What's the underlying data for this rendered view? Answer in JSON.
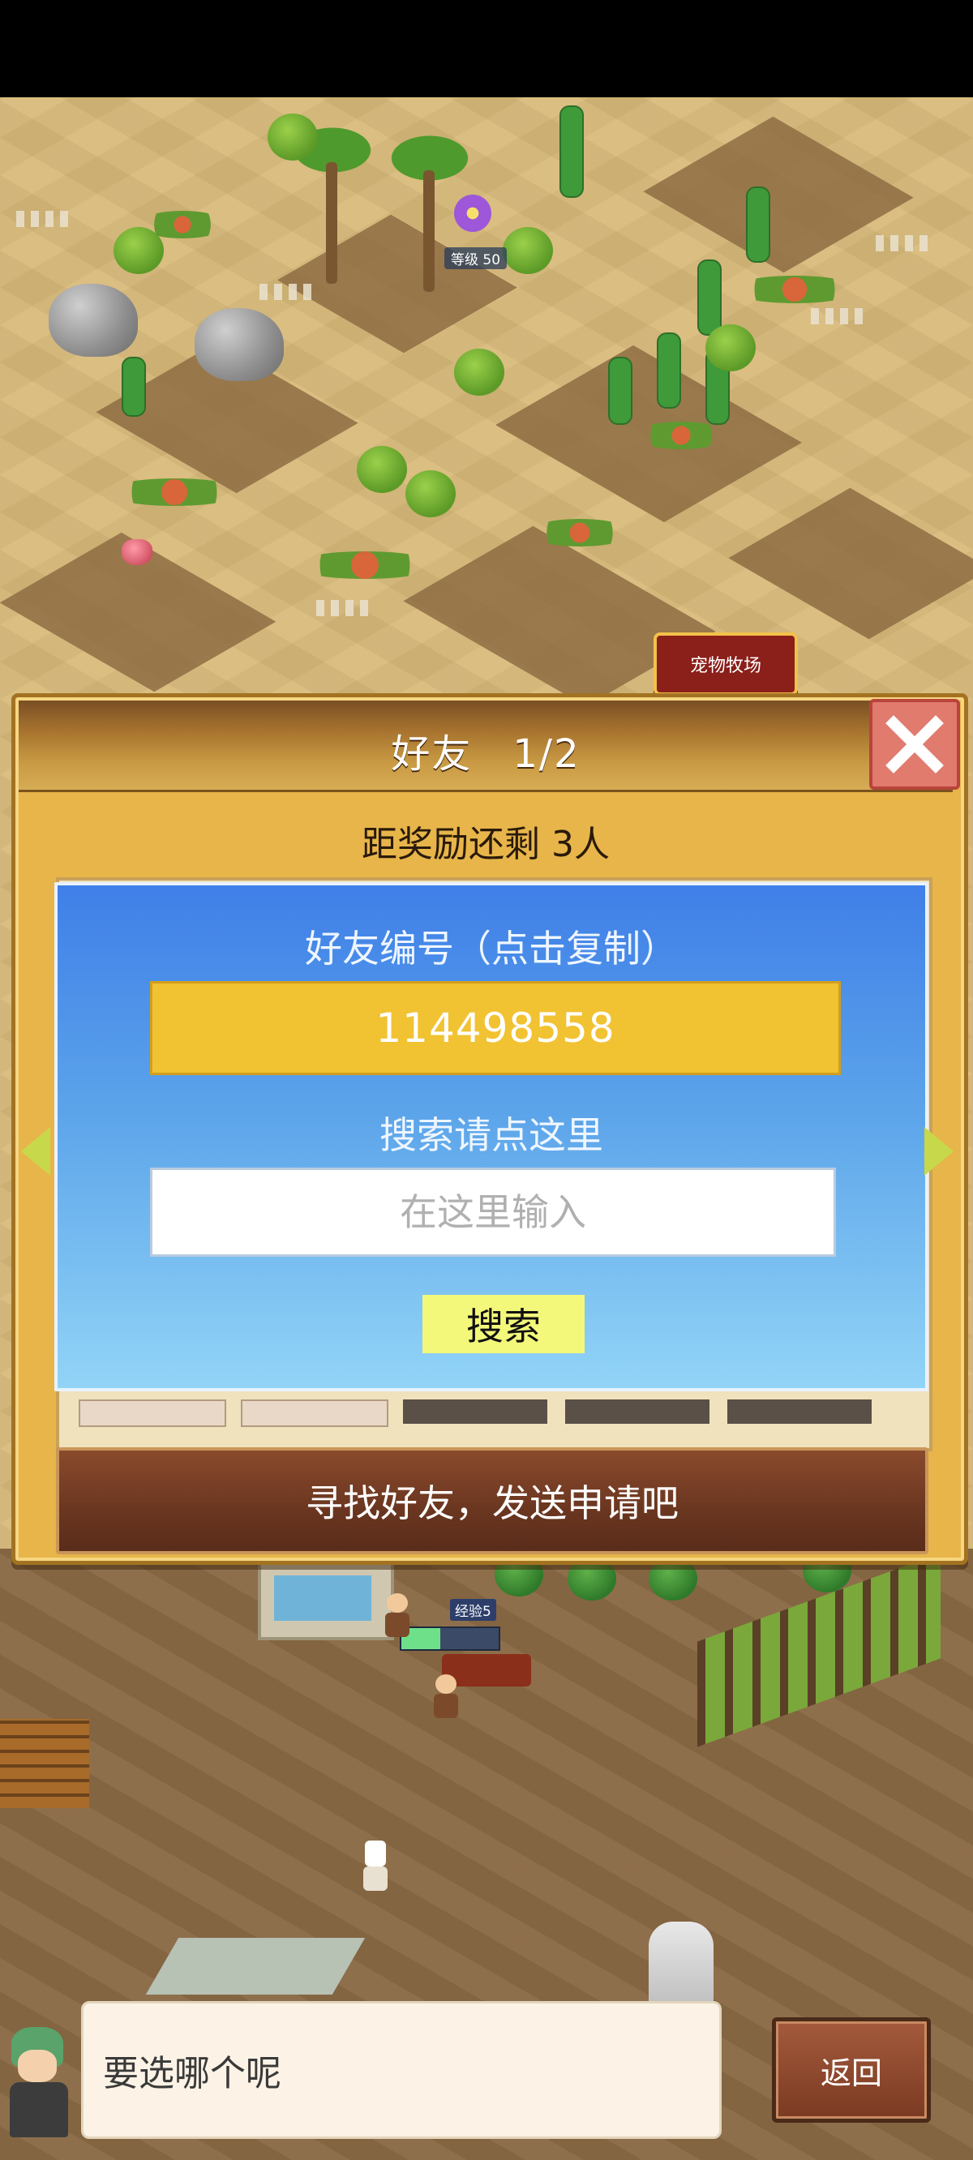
{
  "scene": {
    "pet_ranch_sign": "宠物牧场",
    "level_tag": "等级 50",
    "exp_tag": "经验5"
  },
  "dialog": {
    "title": "好友",
    "page": "1/2",
    "reward_text": "距奖励还剩 3人",
    "friend_id_label": "好友编号（点击复制）",
    "friend_id": "114498558",
    "search_label": "搜索请点这里",
    "search_placeholder": "在这里输入",
    "search_button": "搜索",
    "find_friends": "寻找好友，发送申请吧"
  },
  "message": {
    "text": "要选哪个呢"
  },
  "back_button": "返回",
  "colors": {
    "accent_blue": "#3f7fe8",
    "id_box": "#f1c232",
    "search_button": "#f3f87a",
    "close_button": "#e07b6e"
  }
}
